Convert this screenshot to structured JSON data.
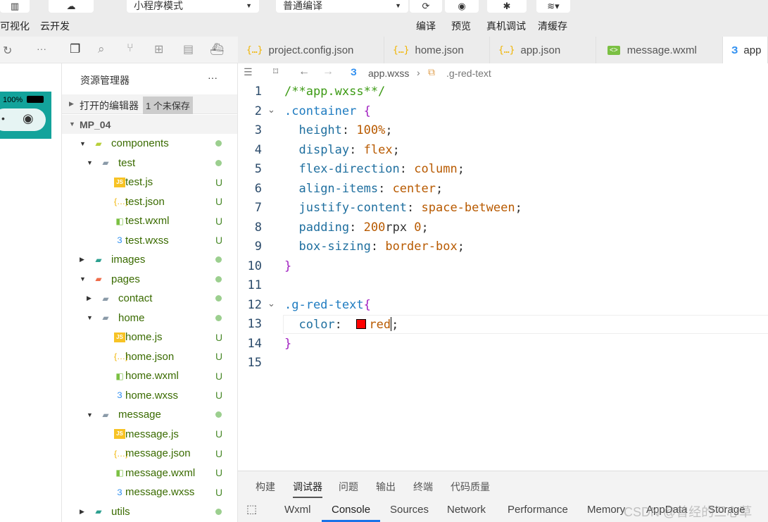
{
  "toolbar": {
    "visual": "可视化",
    "cloud": "云开发",
    "mode": "小程序模式",
    "compile_mode": "普通编译",
    "compile": "编译",
    "preview": "预览",
    "remote_debug": "真机调试",
    "clear_cache": "清缓存"
  },
  "simulator": {
    "battery": "100%"
  },
  "tabs": [
    {
      "label": "project.config.json",
      "icon": "json-icon"
    },
    {
      "label": "home.json",
      "icon": "json-icon"
    },
    {
      "label": "app.json",
      "icon": "json-icon"
    },
    {
      "label": "message.wxml",
      "icon": "wxml-icon"
    },
    {
      "label": "app",
      "icon": "wxss-icon",
      "active": true
    }
  ],
  "explorer": {
    "title": "资源管理器",
    "more": "···",
    "open_editors": "打开的编辑器",
    "unsaved": "1 个未保存",
    "project": "MP_04"
  },
  "tree": [
    {
      "name": "components",
      "type": "folder",
      "level": 1,
      "open": true,
      "status": "dot"
    },
    {
      "name": "test",
      "type": "folder",
      "level": 2,
      "open": true,
      "status": "dot"
    },
    {
      "name": "test.js",
      "type": "js",
      "level": 3,
      "status": "U"
    },
    {
      "name": "test.json",
      "type": "json",
      "level": 3,
      "status": "U"
    },
    {
      "name": "test.wxml",
      "type": "wxml",
      "level": 3,
      "status": "U"
    },
    {
      "name": "test.wxss",
      "type": "wxss",
      "level": 3,
      "status": "U"
    },
    {
      "name": "images",
      "type": "folder",
      "level": 1,
      "open": false,
      "status": "dot"
    },
    {
      "name": "pages",
      "type": "folder",
      "level": 1,
      "open": true,
      "status": "dot"
    },
    {
      "name": "contact",
      "type": "folder",
      "level": 2,
      "open": false,
      "status": "dot"
    },
    {
      "name": "home",
      "type": "folder",
      "level": 2,
      "open": true,
      "status": "dot"
    },
    {
      "name": "home.js",
      "type": "js",
      "level": 3,
      "status": "U"
    },
    {
      "name": "home.json",
      "type": "json",
      "level": 3,
      "status": "U"
    },
    {
      "name": "home.wxml",
      "type": "wxml",
      "level": 3,
      "status": "U"
    },
    {
      "name": "home.wxss",
      "type": "wxss",
      "level": 3,
      "status": "U"
    },
    {
      "name": "message",
      "type": "folder",
      "level": 2,
      "open": true,
      "status": "dot"
    },
    {
      "name": "message.js",
      "type": "js",
      "level": 3,
      "status": "U"
    },
    {
      "name": "message.json",
      "type": "json",
      "level": 3,
      "status": "U"
    },
    {
      "name": "message.wxml",
      "type": "wxml",
      "level": 3,
      "status": "U"
    },
    {
      "name": "message.wxss",
      "type": "wxss",
      "level": 3,
      "status": "U"
    },
    {
      "name": "utils",
      "type": "folder",
      "level": 1,
      "open": false,
      "status": "dot"
    }
  ],
  "breadcrumb": {
    "file": "app.wxss",
    "symbol": ".g-red-text"
  },
  "code": [
    [
      [
        "cm",
        "/**app.wxss**/"
      ]
    ],
    [
      [
        "sl",
        ".container "
      ],
      [
        "br",
        "{"
      ]
    ],
    [
      [
        "",
        "  "
      ],
      [
        "pr",
        "height"
      ],
      [
        "",
        ": "
      ],
      [
        "vl",
        "100%"
      ],
      [
        "",
        ";"
      ]
    ],
    [
      [
        "",
        "  "
      ],
      [
        "pr",
        "display"
      ],
      [
        "",
        ": "
      ],
      [
        "vl",
        "flex"
      ],
      [
        "",
        ";"
      ]
    ],
    [
      [
        "",
        "  "
      ],
      [
        "pr",
        "flex-direction"
      ],
      [
        "",
        ": "
      ],
      [
        "vl",
        "column"
      ],
      [
        "",
        ";"
      ]
    ],
    [
      [
        "",
        "  "
      ],
      [
        "pr",
        "align-items"
      ],
      [
        "",
        ": "
      ],
      [
        "vl",
        "center"
      ],
      [
        "",
        ";"
      ]
    ],
    [
      [
        "",
        "  "
      ],
      [
        "pr",
        "justify-content"
      ],
      [
        "",
        ": "
      ],
      [
        "vl",
        "space-between"
      ],
      [
        "",
        ";"
      ]
    ],
    [
      [
        "",
        "  "
      ],
      [
        "pr",
        "padding"
      ],
      [
        "",
        ": "
      ],
      [
        "vl",
        "200"
      ],
      [
        "",
        "rpx "
      ],
      [
        "vl",
        "0"
      ],
      [
        "",
        ";"
      ]
    ],
    [
      [
        "",
        "  "
      ],
      [
        "pr",
        "box-sizing"
      ],
      [
        "",
        ": "
      ],
      [
        "vl",
        "border-box"
      ],
      [
        "",
        ";"
      ]
    ],
    [
      [
        "br",
        "}"
      ]
    ],
    [],
    [
      [
        "sl",
        ".g-red-text"
      ],
      [
        "br",
        "{"
      ]
    ],
    [
      [
        "",
        "  "
      ],
      [
        "pr",
        "color"
      ],
      [
        "",
        ":  "
      ],
      [
        "sw",
        ""
      ],
      [
        "vl",
        "red"
      ],
      [
        "",
        ";"
      ]
    ],
    [
      [
        "br",
        "}"
      ]
    ],
    []
  ],
  "colors": {
    "swatch": "#ff0000",
    "accent": "#1a73e8"
  },
  "bottom": {
    "tabs": [
      "构建",
      "调试器",
      "问题",
      "输出",
      "终端",
      "代码质量"
    ],
    "active_tab": "调试器",
    "devtools": [
      "Wxml",
      "Console",
      "Sources",
      "Network",
      "Performance",
      "Memory",
      "AppData",
      "Storage"
    ],
    "active_devtool": "Console"
  },
  "watermark": "CSDN @曾经的三心草"
}
